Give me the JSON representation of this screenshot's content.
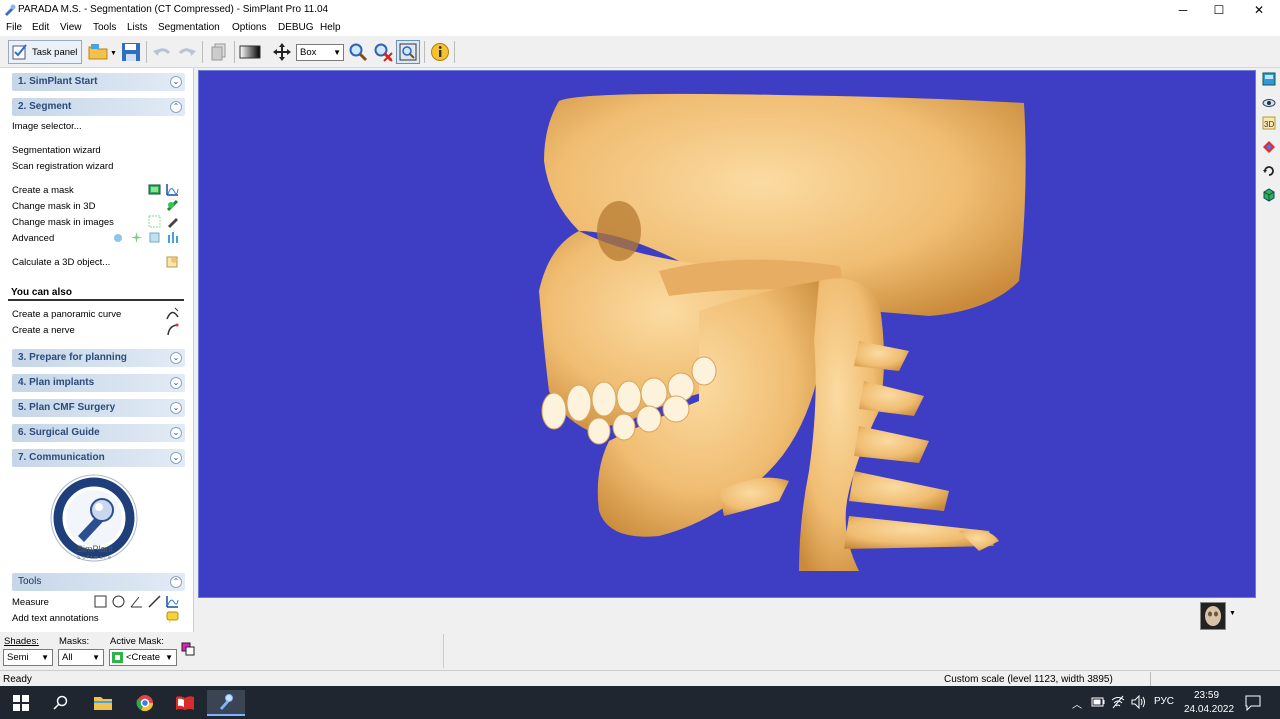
{
  "window": {
    "title": "PARADA M.S. - Segmentation (CT Compressed) - SimPlant Pro  11.04"
  },
  "menu": [
    "File",
    "Edit",
    "View",
    "Tools",
    "Lists",
    "Segmentation",
    "Options",
    "DEBUG",
    "Help"
  ],
  "toolbar": {
    "task_panel": "Task panel",
    "box_select": "Box"
  },
  "panel": {
    "sections": [
      "1. SimPlant Start",
      "2. Segment",
      "3. Prepare for planning",
      "4. Plan implants",
      "5. Plan CMF Surgery",
      "6. Surgical Guide",
      "7. Communication"
    ],
    "segment_items": [
      "Image selector...",
      "Segmentation wizard",
      "Scan registration wizard",
      "Create a mask",
      "Change mask in 3D",
      "Change mask in images",
      "Advanced",
      "Calculate a 3D object..."
    ],
    "you_can_also": "You can also",
    "also_items": [
      "Create a panoramic curve",
      "Create a nerve"
    ],
    "logo_text": "SimPlant",
    "logo_sub": "Software",
    "tools_header": "Tools",
    "tools_items": [
      "Measure",
      "Add text annotations"
    ]
  },
  "bottom": {
    "shades_label": "Shades:",
    "shades_value": "Semi",
    "masks_label": "Masks:",
    "masks_value": "All",
    "active_mask_label": "Active Mask:",
    "active_mask_value": "<Create"
  },
  "status": {
    "ready": "Ready",
    "scale": "Custom scale (level 1123, width 3895)"
  },
  "taskbar": {
    "lang": "РУС",
    "time": "23:59",
    "date": "24.04.2022"
  },
  "colors": {
    "viewport_bg": "#3e3ec4",
    "bone": "#f3c27a",
    "section_text": "#2a4b7c"
  }
}
